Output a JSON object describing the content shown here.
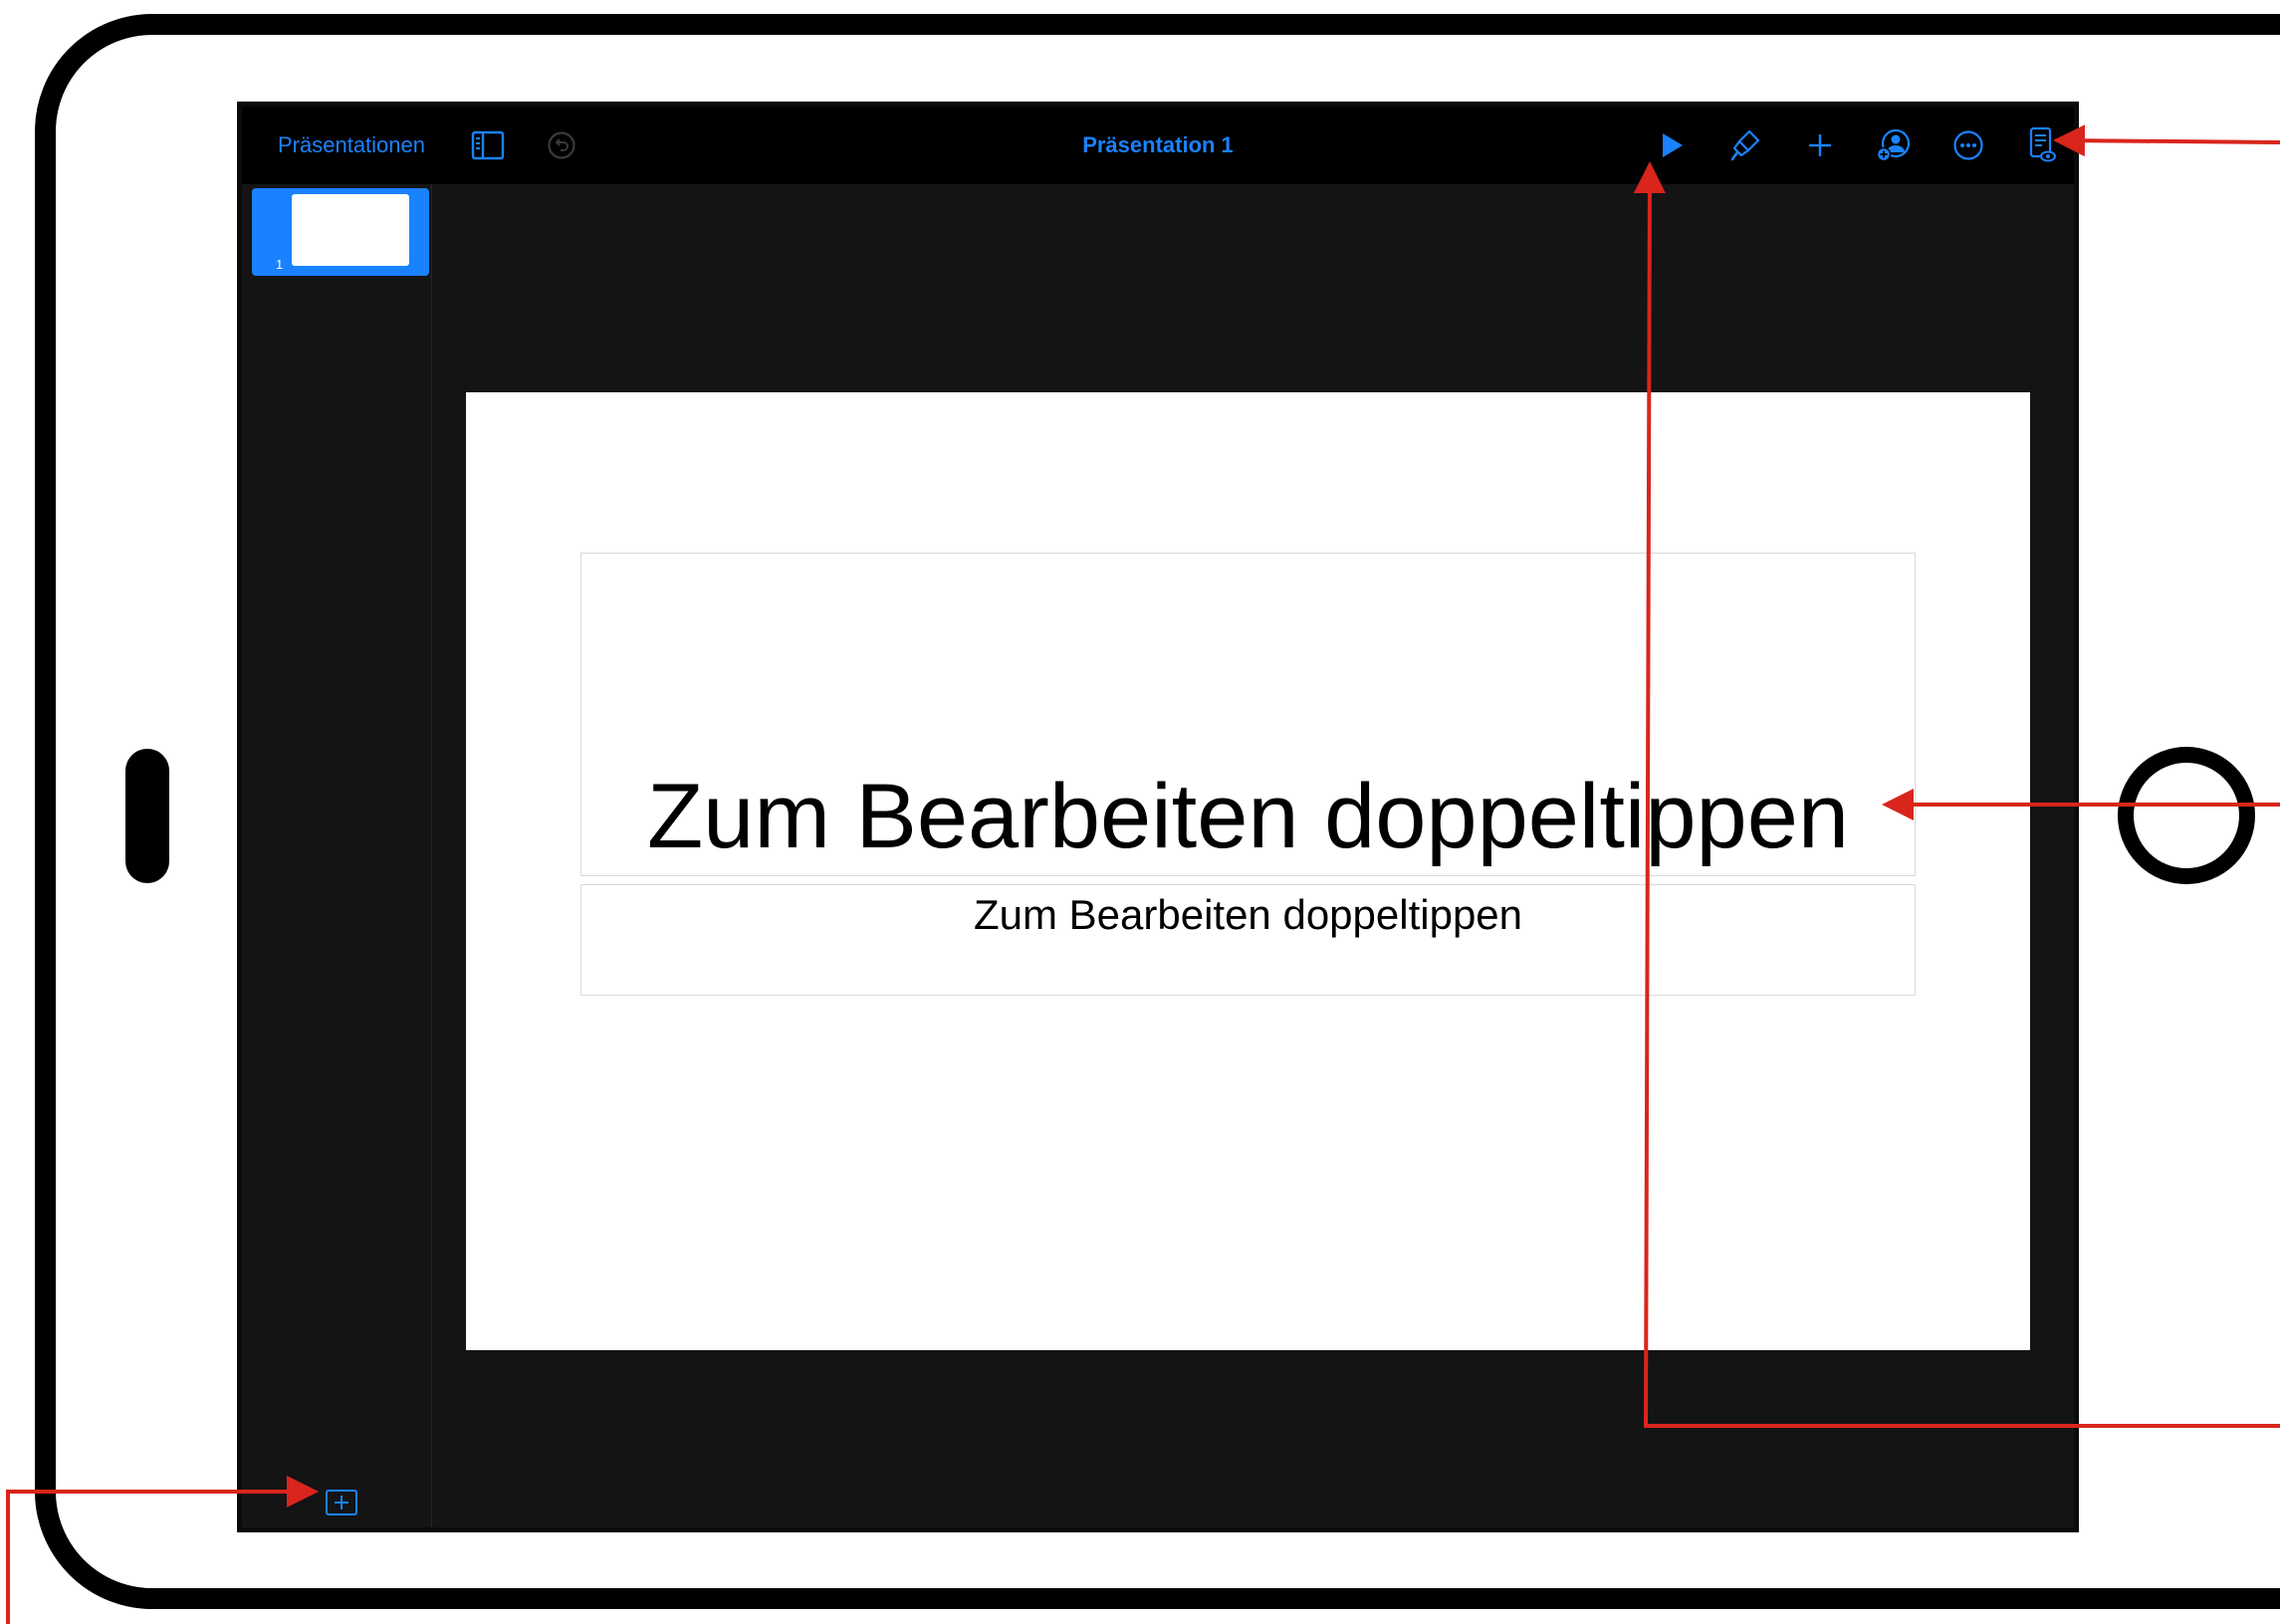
{
  "toolbar": {
    "back_label": "Präsentationen",
    "document_title": "Präsentation 1",
    "icons": {
      "sidebar": "sidebar-toggle-icon",
      "undo": "undo-icon",
      "play": "play-icon",
      "format": "paintbrush-icon",
      "insert": "plus-icon",
      "collaborate": "collaborate-icon",
      "more": "more-icon",
      "presenter_notes": "presenter-notes-icon"
    }
  },
  "navigator": {
    "slides": [
      {
        "number": "1"
      }
    ],
    "add_slide_icon": "add-slide-icon"
  },
  "slide": {
    "title_placeholder": "Zum Bearbeiten doppeltippen",
    "subtitle_placeholder": "Zum Bearbeiten doppeltippen"
  },
  "colors": {
    "accent": "#1a82ff",
    "toolbar_bg": "#000000",
    "canvas_bg": "#141414",
    "annotation": "#d9251c",
    "disabled_icon": "#3a3a3a"
  }
}
